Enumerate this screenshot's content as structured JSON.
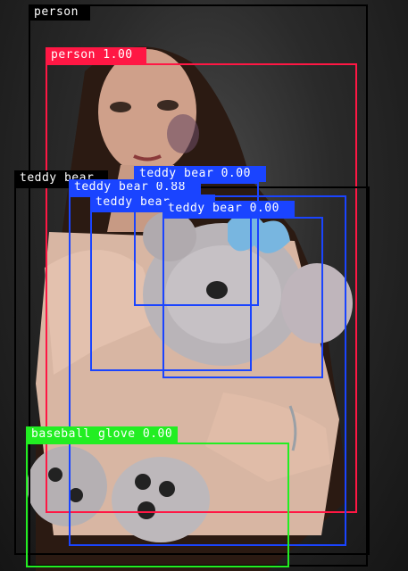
{
  "detections": [
    {
      "label": "person",
      "color": "#000000"
    },
    {
      "label": "person 1.00",
      "color": "#ff1744"
    },
    {
      "label": "teddy bear",
      "color": "#000000"
    },
    {
      "label": "teddy bear 0.00",
      "color": "#1a44ff"
    },
    {
      "label": "teddy bear 0.88",
      "color": "#1a44ff"
    },
    {
      "label": "teddy bear",
      "color": "#1a44ff"
    },
    {
      "label": "teddy bear 0.00",
      "color": "#1a44ff"
    },
    {
      "label": "baseball glove 0.00",
      "color": "#22ee22"
    }
  ]
}
